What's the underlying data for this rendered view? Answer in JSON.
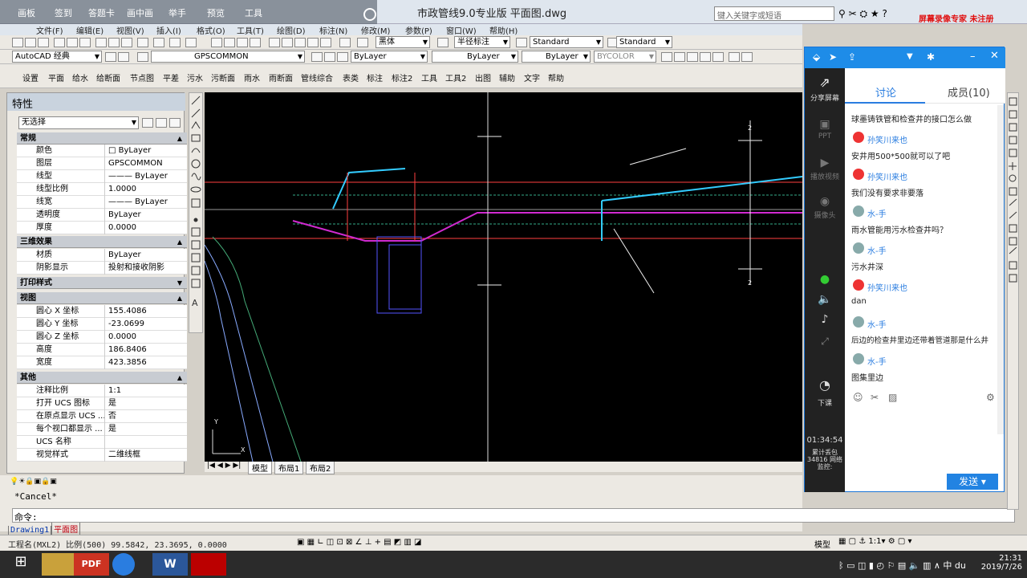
{
  "overlay_tabs": [
    "画板",
    "签到",
    "答题卡",
    "画中画",
    "举手",
    "预览",
    "工具"
  ],
  "title": "市政管线9.0专业版 平面图.dwg",
  "search_placeholder": "键入关键字或短语",
  "recording_banner": "屏幕录像专家 未注册",
  "menus": [
    "文件(F)",
    "编辑(E)",
    "视图(V)",
    "插入(I)",
    "格式(O)",
    "工具(T)",
    "绘图(D)",
    "标注(N)",
    "修改(M)",
    "参数(P)",
    "窗口(W)",
    "帮助(H)"
  ],
  "toolbar2": {
    "font": "黑体",
    "dim": "半径标注",
    "style1": "Standard",
    "style2": "Standard"
  },
  "toolbar3": {
    "workspace": "AutoCAD 经典",
    "layer": "GPSCOMMON",
    "color": "ByLayer",
    "linetype": "ByLayer",
    "lineweight": "ByLayer",
    "plotstyle": "BYCOLOR"
  },
  "commands": [
    "设置",
    "平面",
    "给水",
    "给断面",
    "节点图",
    "平差",
    "污水",
    "污断面",
    "雨水",
    "雨断面",
    "管线综合",
    "表类",
    "标注",
    "标注2",
    "工具",
    "工具2",
    "出图",
    "辅助",
    "文字",
    "帮助"
  ],
  "properties": {
    "title": "特性",
    "selection": "无选择",
    "sections": [
      {
        "name": "常规",
        "rows": [
          [
            "颜色",
            "□ ByLayer"
          ],
          [
            "图层",
            "GPSCOMMON"
          ],
          [
            "线型",
            "——— ByLayer"
          ],
          [
            "线型比例",
            "1.0000"
          ],
          [
            "线宽",
            "——— ByLayer"
          ],
          [
            "透明度",
            "ByLayer"
          ],
          [
            "厚度",
            "0.0000"
          ]
        ]
      },
      {
        "name": "三维效果",
        "rows": [
          [
            "材质",
            "ByLayer"
          ],
          [
            "阴影显示",
            "投射和接收阴影"
          ]
        ]
      },
      {
        "name": "打印样式",
        "rows": []
      },
      {
        "name": "视图",
        "rows": [
          [
            "圆心 X 坐标",
            "155.4086"
          ],
          [
            "圆心 Y 坐标",
            "-23.0699"
          ],
          [
            "圆心 Z 坐标",
            "0.0000"
          ],
          [
            "高度",
            "186.8406"
          ],
          [
            "宽度",
            "423.3856"
          ]
        ]
      },
      {
        "name": "其他",
        "rows": [
          [
            "注释比例",
            "1:1"
          ],
          [
            "打开 UCS 图标",
            "是"
          ],
          [
            "在原点显示 UCS ...",
            "否"
          ],
          [
            "每个视口都显示 ...",
            "是"
          ],
          [
            "UCS 名称",
            ""
          ],
          [
            "视觉样式",
            "二维线框"
          ]
        ]
      }
    ]
  },
  "layout_tabs": [
    "模型",
    "布局1",
    "布局2"
  ],
  "command_history": "*Cancel*",
  "command_prompt": "命令:",
  "doc_tabs": [
    "Drawing1",
    "平面图"
  ],
  "status_coords": "工程名(MXL2) 比例(500)  99.5842,  23.3695, 0.0000",
  "status_right": "模型",
  "chat": {
    "tabs": [
      "讨论",
      "成员(10)"
    ],
    "side": [
      "分享屏幕",
      "PPT",
      "播放视频",
      "摄像头",
      "下课"
    ],
    "timer": "01:34:54",
    "stats": "累计丢包 34816 网络监控:",
    "messages": [
      {
        "name": "",
        "text": "球墨铸铁管和检查井的接口怎么做"
      },
      {
        "name": "孙笑川来也",
        "text": "安井用500*500就可以了吧"
      },
      {
        "name": "孙笑川来也",
        "text": "我们没有要求非要落"
      },
      {
        "name": "水-手",
        "text": "雨水管能用污水检查井吗？"
      },
      {
        "name": "水-手",
        "text": "污水井深"
      },
      {
        "name": "孙笑川来也",
        "text": "dan"
      },
      {
        "name": "水-手",
        "text": "后边的检查井里边还带着管道那是什么井"
      },
      {
        "name": "水-手",
        "text": "图集里边"
      }
    ],
    "send": "发送"
  },
  "clock": {
    "time": "21:31",
    "date": "2019/7/26"
  }
}
